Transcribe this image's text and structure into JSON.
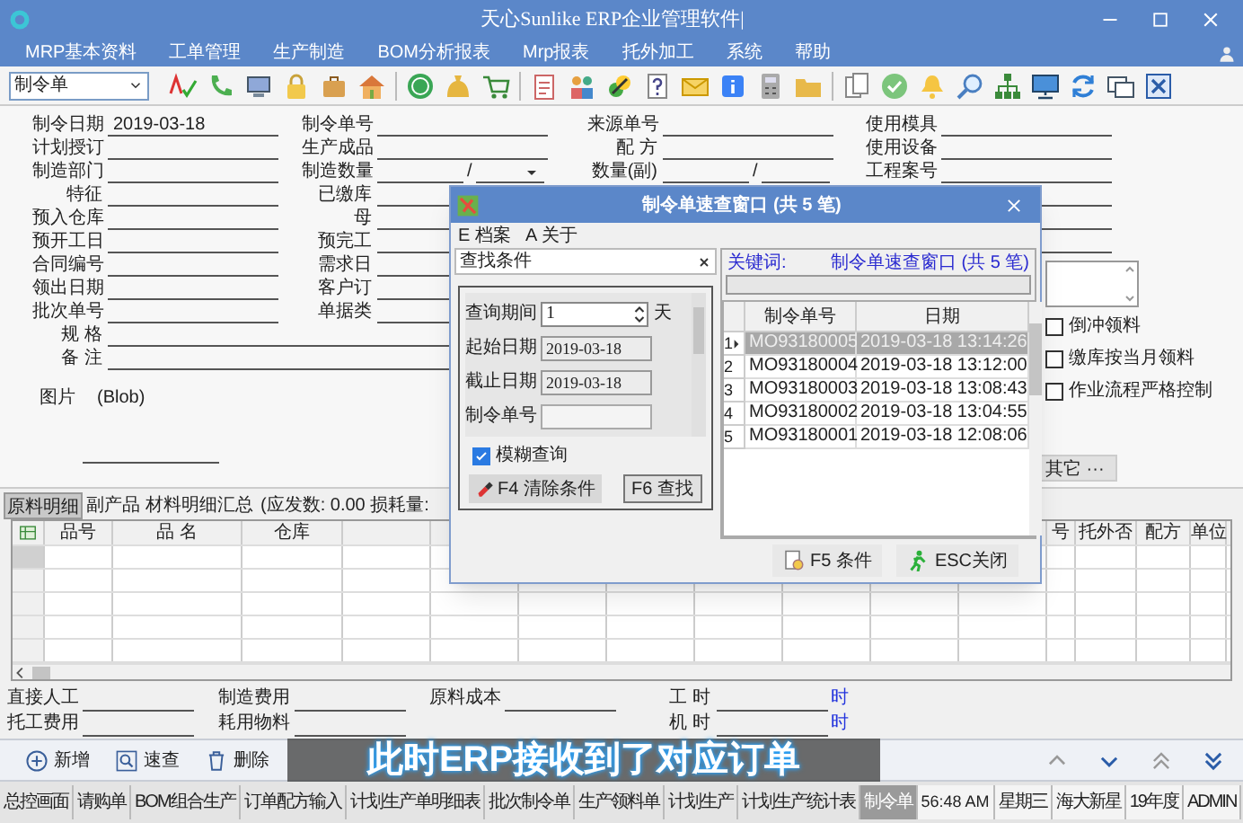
{
  "window": {
    "title": "天心Sunlike ERP企业管理软件|"
  },
  "menu": [
    "MRP基本资料",
    "工单管理",
    "生产制造",
    "BOM分析报表",
    "Mrp报表",
    "托外加工",
    "系统",
    "帮助"
  ],
  "toolbar": {
    "document_type": "制令单"
  },
  "form": {
    "column_1": [
      {
        "label": "制令日期",
        "value": "2019-03-18",
        "kind": "line"
      },
      {
        "label": "计划授订",
        "kind": "line"
      },
      {
        "label": "制造部门",
        "kind": "line"
      },
      {
        "label": "特征",
        "kind": "line"
      },
      {
        "label": "预入仓库",
        "kind": "line"
      },
      {
        "label": "预开工日",
        "kind": "line"
      },
      {
        "label": "合同编号",
        "kind": "line"
      },
      {
        "label": "领出日期",
        "kind": "line"
      },
      {
        "label": "批次单号",
        "kind": "line"
      },
      {
        "label": "规 格",
        "kind": "wide"
      },
      {
        "label": "备 注",
        "kind": "wide"
      }
    ],
    "image": {
      "label": "图片",
      "value": "(Blob)"
    },
    "column_2": [
      {
        "label": "制令单号",
        "kind": "line"
      },
      {
        "label": "生产成品",
        "kind": "line"
      },
      {
        "label": "制造数量",
        "kind": "split",
        "separator": "/",
        "dropdown": true
      },
      {
        "label": "已缴库",
        "kind": "line"
      },
      {
        "label": "母",
        "kind": "line"
      },
      {
        "label": "预完工",
        "kind": "line"
      },
      {
        "label": "需求日",
        "kind": "line"
      },
      {
        "label": "客户订",
        "kind": "line"
      },
      {
        "label": "单据类",
        "kind": "line"
      }
    ],
    "column_3": [
      {
        "label": "来源单号",
        "kind": "line"
      },
      {
        "label": "配 方",
        "kind": "line"
      },
      {
        "label": "数量(副)",
        "kind": "split",
        "separator": "/",
        "dropdown": false
      }
    ],
    "column_4": [
      {
        "label": "使用模具",
        "kind": "line"
      },
      {
        "label": "使用设备",
        "kind": "line"
      },
      {
        "label": "工程案号",
        "kind": "line"
      },
      {
        "kind": "blank"
      },
      {
        "kind": "blank"
      },
      {
        "kind": "blank"
      }
    ],
    "checkboxes": [
      {
        "label": "倒冲领料",
        "checked": false
      },
      {
        "label": "缴库按当月领料",
        "checked": false
      },
      {
        "label": "作业流程严格控制",
        "checked": false
      }
    ],
    "more_button": "其它 ···"
  },
  "detail_tabs": [
    {
      "label": "原料明细",
      "selected": true
    },
    {
      "label": "副产品",
      "selected": false
    },
    {
      "label": "材料明细汇总",
      "selected": false
    }
  ],
  "detail_info": "(应发数: 0.00 损耗量:",
  "detail_grid": {
    "columns": [
      "品号",
      "品 名",
      "仓库",
      "号",
      "托外否",
      "配方",
      "单位"
    ]
  },
  "summary": [
    [
      {
        "label": "直接人工"
      },
      {
        "label": "制造费用"
      },
      {
        "label": "原料成本"
      },
      {
        "label": "工 时",
        "unit": "时"
      }
    ],
    [
      {
        "label": "托工费用"
      },
      {
        "label": "耗用物料"
      },
      {
        "label": "机 时",
        "unit": "时"
      }
    ]
  ],
  "actions": [
    "新增",
    "速查",
    "删除"
  ],
  "taskbar": {
    "items": [
      {
        "label": "总控画面",
        "selected": false
      },
      {
        "label": "请购单",
        "selected": false
      },
      {
        "label": "BOM组合生产",
        "selected": false
      },
      {
        "label": "订单配方输入",
        "selected": false
      },
      {
        "label": "计划生产单明细表",
        "selected": false
      },
      {
        "label": "批次制令单",
        "selected": false
      },
      {
        "label": "生产领料单",
        "selected": false
      },
      {
        "label": "计划生产",
        "selected": false
      },
      {
        "label": "计划生产统计表",
        "selected": false
      },
      {
        "label": "制令单",
        "selected": true
      }
    ],
    "status": [
      "56:48 AM",
      "星期三",
      "海大新星",
      "19年度",
      "ADMIN"
    ]
  },
  "dialog": {
    "title": "制令单速查窗口 (共 5 笔)",
    "menu": [
      "E 档案",
      "A 关于"
    ],
    "filter_panel": {
      "title": "查找条件",
      "fields": [
        {
          "label": "查询期间",
          "value": "1",
          "unit": "天",
          "kind": "spinner"
        },
        {
          "label": "起始日期",
          "value": "2019-03-18",
          "kind": "readonly"
        },
        {
          "label": "截止日期",
          "value": "2019-03-18",
          "kind": "readonly"
        },
        {
          "label": "制令单号",
          "kind": "text"
        }
      ],
      "fuzzy_search": {
        "label": "模糊查询",
        "checked": true
      },
      "buttons": [
        "F4 清除条件",
        "F6 查找"
      ]
    },
    "results": {
      "keyword_label": "关键词:",
      "caption": "制令单速查窗口 (共 5 笔)",
      "columns": [
        "制令单号",
        "日期"
      ],
      "rows": [
        {
          "number": "1",
          "order_no": "MO93180005",
          "date": "2019-03-18 13:14:26",
          "selected": true
        },
        {
          "number": "2",
          "order_no": "MO93180004",
          "date": "2019-03-18 13:12:00",
          "selected": false
        },
        {
          "number": "3",
          "order_no": "MO93180003",
          "date": "2019-03-18 13:08:43",
          "selected": false
        },
        {
          "number": "4",
          "order_no": "MO93180002",
          "date": "2019-03-18 13:04:55",
          "selected": false
        },
        {
          "number": "5",
          "order_no": "MO93180001",
          "date": "2019-03-18 12:08:06",
          "selected": false
        }
      ]
    },
    "buttons": [
      "F5 条件",
      "ESC关闭"
    ]
  },
  "caption": "此时ERP接收到了对应订单"
}
